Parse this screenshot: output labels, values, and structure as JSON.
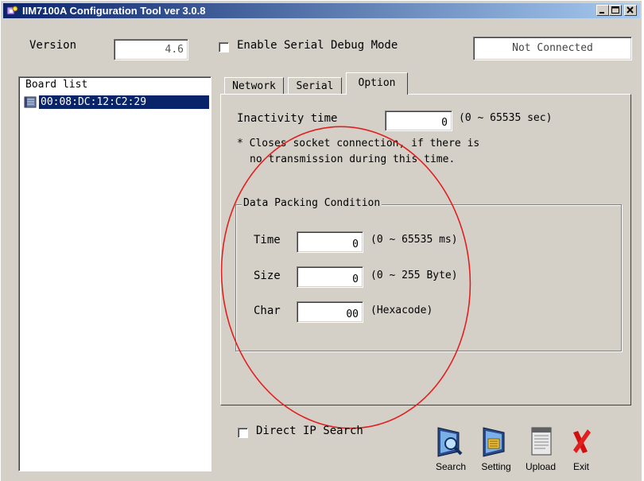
{
  "window": {
    "title": "IIM7100A Configuration Tool ver 3.0.8",
    "controls": {
      "minimize": "_",
      "maximize": "□",
      "close": "×"
    }
  },
  "top": {
    "version_label": "Version",
    "version_value": "4.6",
    "serial_debug_label": "Enable Serial Debug Mode",
    "serial_debug_checked": false,
    "connection_status": "Not Connected"
  },
  "board_list": {
    "header": "Board list",
    "items": [
      {
        "label": "00:08:DC:12:C2:29",
        "selected": true
      }
    ]
  },
  "tabs": [
    {
      "label": "Network",
      "active": false
    },
    {
      "label": "Serial",
      "active": false
    },
    {
      "label": "Option",
      "active": true
    }
  ],
  "option": {
    "inactivity_label": "Inactivity time",
    "inactivity_value": "0",
    "inactivity_range": "(0 ~ 65535 sec)",
    "note_line1": "* Closes socket connection, if there is",
    "note_line2": "no transmission during this time.",
    "packing": {
      "title": "Data Packing Condition",
      "time_label": "Time",
      "time_value": "0",
      "time_range": "(0 ~ 65535 ms)",
      "size_label": "Size",
      "size_value": "0",
      "size_range": "(0 ~ 255 Byte)",
      "char_label": "Char",
      "char_value": "00",
      "char_hint": "(Hexacode)"
    }
  },
  "bottom": {
    "direct_ip_label": "Direct IP Search",
    "direct_ip_checked": false,
    "toolbar": [
      {
        "label": "Search",
        "icon": "search-monitor-icon"
      },
      {
        "label": "Setting",
        "icon": "setting-monitor-icon"
      },
      {
        "label": "Upload",
        "icon": "upload-document-icon"
      },
      {
        "label": "Exit",
        "icon": "exit-x-icon"
      }
    ]
  },
  "annotation": {
    "type": "ellipse",
    "color": "#e02020"
  }
}
